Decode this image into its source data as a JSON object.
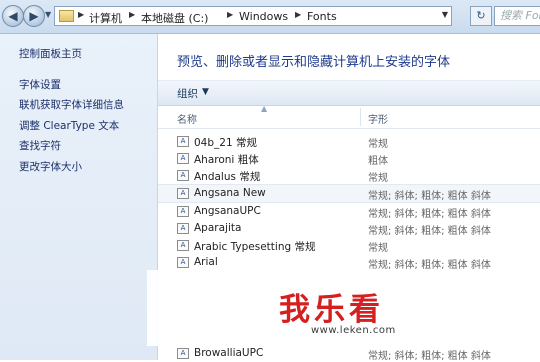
{
  "addressbar": {
    "breadcrumbs": [
      "计算机",
      "本地磁盘 (C:)",
      "Windows",
      "Fonts"
    ],
    "search_placeholder": "搜索 Fonts",
    "refresh_glyph": "↻"
  },
  "leftpane": {
    "home_link": "控制面板主页",
    "links": [
      "字体设置",
      "联机获取字体详细信息",
      "调整 ClearType 文本",
      "查找字符",
      "更改字体大小"
    ]
  },
  "main": {
    "heading": "预览、删除或者显示和隐藏计算机上安装的字体",
    "toolbar": {
      "organize_label": "组织"
    },
    "columns": {
      "name": "名称",
      "style": "字形"
    },
    "fonts": [
      {
        "icon": "A",
        "name": "04b_21 常规",
        "style": "常规"
      },
      {
        "icon": "A",
        "name": "Aharoni 粗体",
        "style": "粗体"
      },
      {
        "icon": "A",
        "name": "Andalus 常规",
        "style": "常规"
      },
      {
        "icon": "A",
        "name": "Angsana New",
        "style": "常规; 斜体; 粗体; 粗体 斜体"
      },
      {
        "icon": "A",
        "name": "AngsanaUPC",
        "style": "常规; 斜体; 粗体; 粗体 斜体"
      },
      {
        "icon": "A",
        "name": "Aparajita",
        "style": "常规; 斜体; 粗体; 粗体 斜体"
      },
      {
        "icon": "A",
        "name": "Arabic Typesetting 常规",
        "style": "常规"
      },
      {
        "icon": "A",
        "name": "Arial",
        "style": "常规; 斜体; 粗体; 粗体 斜体"
      }
    ],
    "last_font": {
      "icon": "A",
      "name": "BrowalliaUPC",
      "style": "常规; 斜体; 粗体; 粗体 斜体"
    }
  },
  "watermark": {
    "logo": "我乐看",
    "url": "www.leken.com"
  }
}
